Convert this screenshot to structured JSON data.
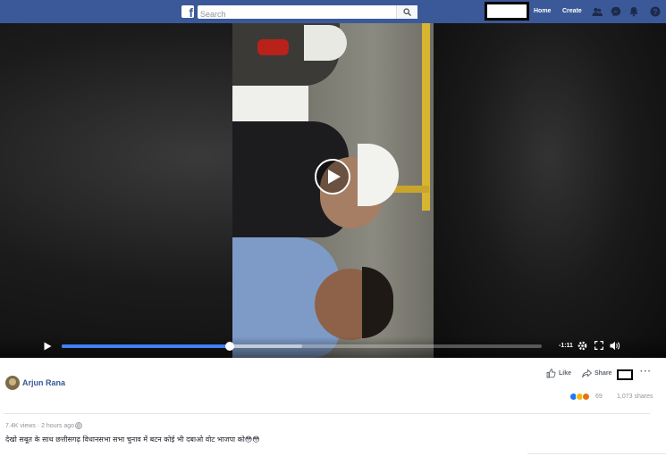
{
  "topbar": {
    "logo": "f",
    "search_placeholder": "Search",
    "home": "Home",
    "create": "Create",
    "icons": [
      "friends-icon",
      "messenger-icon",
      "notifications-icon",
      "help-icon"
    ],
    "color": "#3b5998"
  },
  "video": {
    "time_remaining": "-1:11",
    "progress_fraction": 0.35,
    "buffer_fraction": 0.5,
    "progress_color": "#4080ff",
    "controls": [
      "play-icon",
      "settings-icon",
      "fullscreen-icon",
      "volume-icon"
    ]
  },
  "post": {
    "author": "Arjun Rana",
    "actions": {
      "like": "Like",
      "share": "Share"
    },
    "reactions": [
      "like",
      "haha",
      "wow"
    ],
    "reaction_count": "69",
    "shares": "1,073 shares",
    "meta": "7.4K views · 2 hours ago ·",
    "caption": "देखो सबूत के साथ छत्तीसगढ़ विधानसभा सभा चुनाव में बटन कोई भी दबाओ वोट भाजपा को😳😳"
  }
}
